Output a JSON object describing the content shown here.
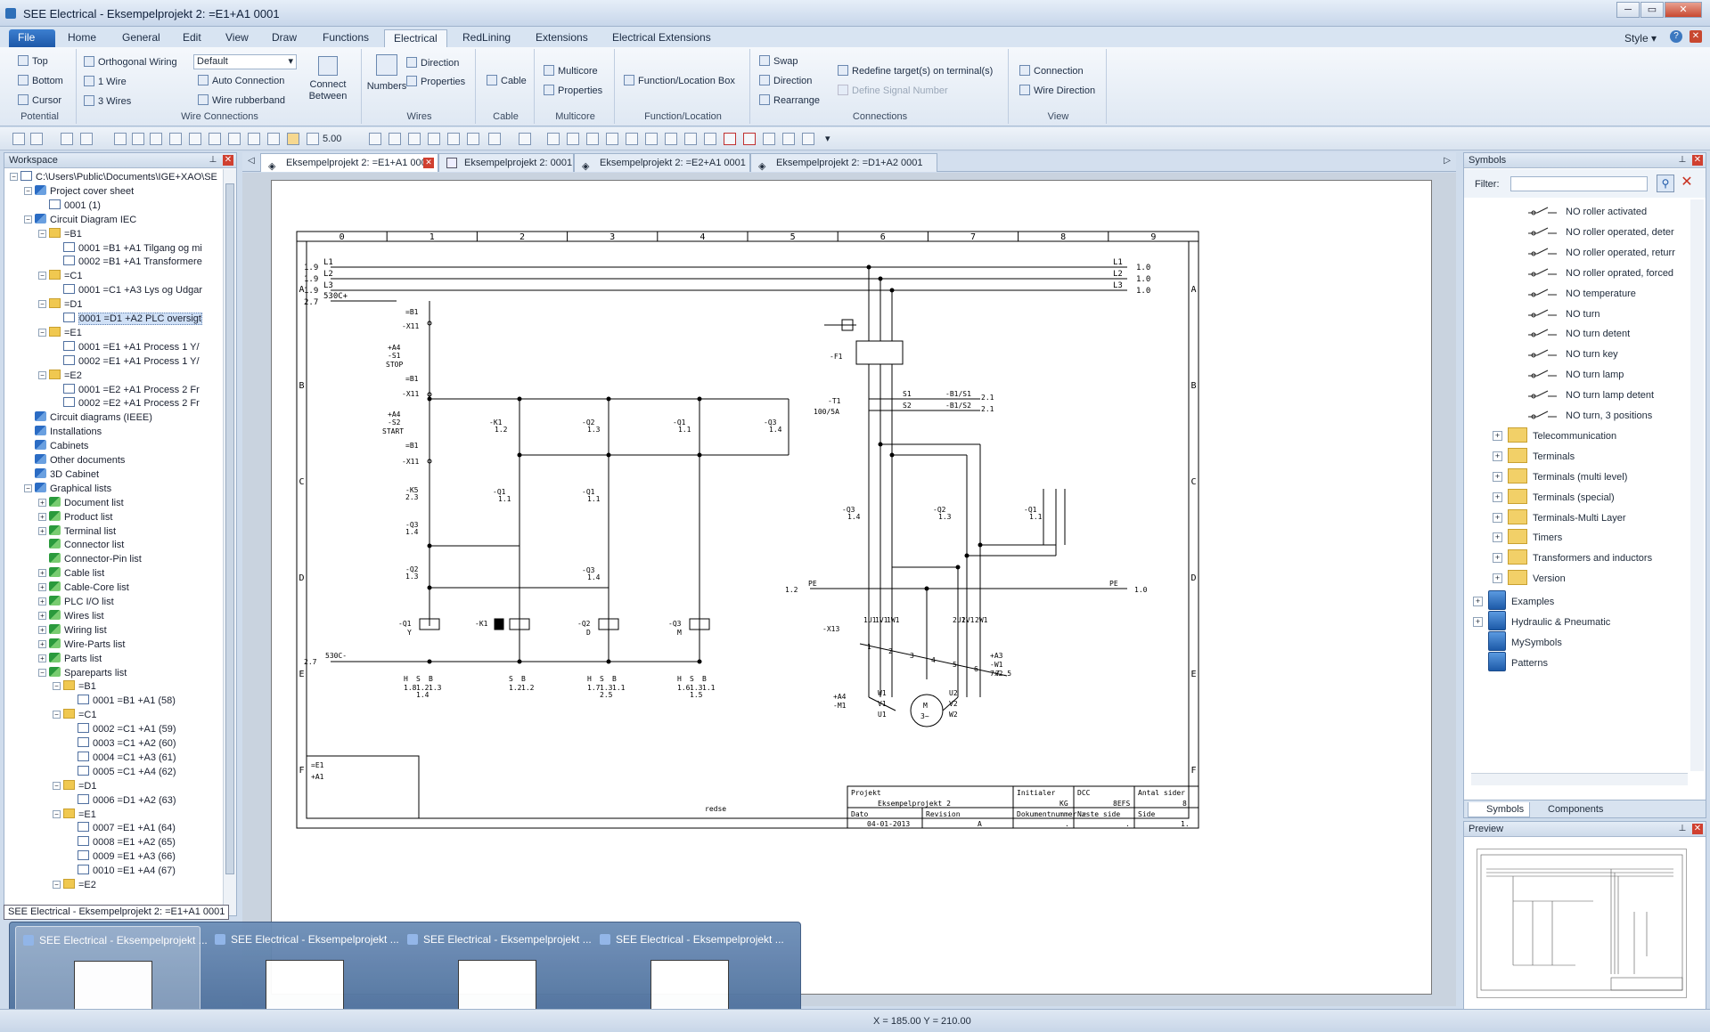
{
  "window": {
    "title": "SEE Electrical - Eksempelprojekt 2: =E1+A1 0001"
  },
  "ribbon_tabs": [
    "File",
    "Home",
    "General",
    "Edit",
    "View",
    "Draw",
    "Functions",
    "Electrical",
    "RedLining",
    "Extensions",
    "Electrical Extensions"
  ],
  "style_menu": "Style",
  "ribbon": {
    "potential": {
      "label": "Potential",
      "top": "Top",
      "bottom": "Bottom",
      "cursor": "Cursor"
    },
    "wire_connections": {
      "label": "Wire Connections",
      "orthogonal": "Orthogonal Wiring",
      "mode_value": "Default",
      "one_wire": "1 Wire",
      "three_wires": "3 Wires",
      "auto_connection": "Auto Connection",
      "wire_rubberband": "Wire rubberband",
      "connect_between": "Connect Between"
    },
    "wires": {
      "label": "Wires",
      "numbers": "Numbers",
      "direction": "Direction",
      "properties": "Properties"
    },
    "cable": {
      "label": "Cable",
      "cable": "Cable"
    },
    "multicore": {
      "label": "Multicore",
      "multicore": "Multicore",
      "properties": "Properties"
    },
    "function_location": {
      "label": "Function/Location",
      "box": "Function/Location Box"
    },
    "connections": {
      "label": "Connections",
      "swap": "Swap",
      "direction": "Direction",
      "rearrange": "Rearrange",
      "redefine": "Redefine target(s) on terminal(s)",
      "define_signal": "Define Signal Number"
    },
    "view": {
      "label": "View",
      "connection": "Connection",
      "wire_direction": "Wire Direction"
    }
  },
  "toolbar": {
    "zoom": "5.00"
  },
  "workspace": {
    "title": "Workspace",
    "tree": [
      {
        "label": "C:\\Users\\Public\\Documents\\IGE+XAO\\SE",
        "level": 0,
        "icon": "drive",
        "exp": "-"
      },
      {
        "label": "Project cover sheet",
        "level": 1,
        "icon": "diamond",
        "exp": "-"
      },
      {
        "label": "0001  (1)",
        "level": 2,
        "icon": "page",
        "exp": ""
      },
      {
        "label": "Circuit Diagram IEC",
        "level": 1,
        "icon": "diamond",
        "exp": "-"
      },
      {
        "label": "=B1",
        "level": 2,
        "icon": "folder",
        "exp": "-"
      },
      {
        "label": "0001 =B1 +A1 Tilgang og mi",
        "level": 3,
        "icon": "page",
        "exp": ""
      },
      {
        "label": "0002 =B1 +A1 Transformere",
        "level": 3,
        "icon": "page",
        "exp": ""
      },
      {
        "label": "=C1",
        "level": 2,
        "icon": "folder",
        "exp": "-"
      },
      {
        "label": "0001 =C1 +A3 Lys og Udgar",
        "level": 3,
        "icon": "page",
        "exp": ""
      },
      {
        "label": "=D1",
        "level": 2,
        "icon": "folder",
        "exp": "-"
      },
      {
        "label": "0001 =D1 +A2 PLC oversigt",
        "level": 3,
        "icon": "page",
        "exp": "",
        "selected": true
      },
      {
        "label": "=E1",
        "level": 2,
        "icon": "folder",
        "exp": "-"
      },
      {
        "label": "0001 =E1 +A1 Process 1 Y/",
        "level": 3,
        "icon": "page",
        "exp": ""
      },
      {
        "label": "0002 =E1 +A1 Process 1 Y/",
        "level": 3,
        "icon": "page",
        "exp": ""
      },
      {
        "label": "=E2",
        "level": 2,
        "icon": "folder",
        "exp": "-"
      },
      {
        "label": "0001 =E2 +A1 Process 2 Fr",
        "level": 3,
        "icon": "page",
        "exp": ""
      },
      {
        "label": "0002 =E2 +A1 Process 2 Fr",
        "level": 3,
        "icon": "page",
        "exp": ""
      },
      {
        "label": "Circuit diagrams (IEEE)",
        "level": 1,
        "icon": "diamond",
        "exp": ""
      },
      {
        "label": "Installations",
        "level": 1,
        "icon": "diamond",
        "exp": ""
      },
      {
        "label": "Cabinets",
        "level": 1,
        "icon": "diamond",
        "exp": ""
      },
      {
        "label": "Other documents",
        "level": 1,
        "icon": "diamond",
        "exp": ""
      },
      {
        "label": "3D Cabinet",
        "level": 1,
        "icon": "diamond",
        "exp": ""
      },
      {
        "label": "Graphical lists",
        "level": 1,
        "icon": "diamond",
        "exp": "-"
      },
      {
        "label": "Document list",
        "level": 2,
        "icon": "green",
        "exp": "+"
      },
      {
        "label": "Product list",
        "level": 2,
        "icon": "green",
        "exp": "+"
      },
      {
        "label": "Terminal list",
        "level": 2,
        "icon": "green",
        "exp": "+"
      },
      {
        "label": "Connector list",
        "level": 2,
        "icon": "green",
        "exp": ""
      },
      {
        "label": "Connector-Pin list",
        "level": 2,
        "icon": "green",
        "exp": ""
      },
      {
        "label": "Cable list",
        "level": 2,
        "icon": "green",
        "exp": "+"
      },
      {
        "label": "Cable-Core list",
        "level": 2,
        "icon": "green",
        "exp": "+"
      },
      {
        "label": "PLC I/O list",
        "level": 2,
        "icon": "green",
        "exp": "+"
      },
      {
        "label": "Wires list",
        "level": 2,
        "icon": "green",
        "exp": "+"
      },
      {
        "label": "Wiring list",
        "level": 2,
        "icon": "green",
        "exp": "+"
      },
      {
        "label": "Wire-Parts list",
        "level": 2,
        "icon": "green",
        "exp": "+"
      },
      {
        "label": "Parts list",
        "level": 2,
        "icon": "green",
        "exp": "+"
      },
      {
        "label": "Spareparts list",
        "level": 2,
        "icon": "green",
        "exp": "-"
      },
      {
        "label": "=B1",
        "level": 3,
        "icon": "folder",
        "exp": "-"
      },
      {
        "label": "0001 =B1 +A1 (58)",
        "level": 4,
        "icon": "page",
        "exp": ""
      },
      {
        "label": "=C1",
        "level": 3,
        "icon": "folder",
        "exp": "-"
      },
      {
        "label": "0002 =C1 +A1 (59)",
        "level": 4,
        "icon": "page",
        "exp": ""
      },
      {
        "label": "0003 =C1 +A2 (60)",
        "level": 4,
        "icon": "page",
        "exp": ""
      },
      {
        "label": "0004 =C1 +A3 (61)",
        "level": 4,
        "icon": "page",
        "exp": ""
      },
      {
        "label": "0005 =C1 +A4 (62)",
        "level": 4,
        "icon": "page",
        "exp": ""
      },
      {
        "label": "=D1",
        "level": 3,
        "icon": "folder",
        "exp": "-"
      },
      {
        "label": "0006 =D1 +A2 (63)",
        "level": 4,
        "icon": "page",
        "exp": ""
      },
      {
        "label": "=E1",
        "level": 3,
        "icon": "folder",
        "exp": "-"
      },
      {
        "label": "0007 =E1 +A1 (64)",
        "level": 4,
        "icon": "page",
        "exp": ""
      },
      {
        "label": "0008 =E1 +A2 (65)",
        "level": 4,
        "icon": "page",
        "exp": ""
      },
      {
        "label": "0009 =E1 +A3 (66)",
        "level": 4,
        "icon": "page",
        "exp": ""
      },
      {
        "label": "0010 =E1 +A4 (67)",
        "level": 4,
        "icon": "page",
        "exp": ""
      },
      {
        "label": "=E2",
        "level": 3,
        "icon": "folder",
        "exp": "-"
      }
    ]
  },
  "doc_tabs": [
    {
      "label": "Eksempelprojekt 2: =E1+A1 0001",
      "active": true
    },
    {
      "label": "Eksempelprojekt 2: 0001",
      "active": false
    },
    {
      "label": "Eksempelprojekt 2: =E2+A1 0001",
      "active": false
    },
    {
      "label": "Eksempelprojekt 2: =D1+A2 0001",
      "active": false
    }
  ],
  "drawing": {
    "columns": [
      "0",
      "1",
      "2",
      "3",
      "4",
      "5",
      "6",
      "7",
      "8",
      "9"
    ],
    "rows": [
      "A",
      "B",
      "C",
      "D",
      "E",
      "F"
    ],
    "left_refs": [
      "1.9",
      "1.9",
      "1.9",
      "2.7"
    ],
    "left_nets": [
      "L1",
      "L2",
      "L3",
      "530C+"
    ],
    "right_nets": [
      "L1",
      "L2",
      "L3"
    ],
    "right_refs": [
      "1.0",
      "1.0",
      "1.0"
    ],
    "control": {
      "b1_a": "=B1",
      "x11_a": "-X11",
      "s1_a4": "+A4",
      "s1": "-S1",
      "stop": "STOP",
      "b1_b": "=B1",
      "x11_b": "-X11",
      "s2_a4": "+A4",
      "s2": "-S2",
      "start": "START",
      "b1_c": "=B1",
      "x11_c": "-X11",
      "k5": "-K5",
      "k5_ref": "2.3",
      "q3": "-Q3",
      "q3_ref": "1.4",
      "q2": "-Q2",
      "q2_ref": "1.3",
      "k1": "-K1",
      "k1_ref": "1.2",
      "q2b": "-Q2",
      "q2b_ref": "1.3",
      "q1b": "-Q1",
      "q1b_ref": "1.1",
      "q3b": "-Q3",
      "q3b_ref": "1.4",
      "q1c": "-Q1",
      "q1c_ref": "1.1",
      "q1d": "-Q1",
      "q1d_ref": "1.1",
      "q3c": "-Q3",
      "q3c_ref": "1.4",
      "coil_q1": "-Q1",
      "coil_q1_sub": "Y",
      "coil_k1": "-K1",
      "coil_q2": "-Q2",
      "coil_q2_sub": "D",
      "coil_q3": "-Q3",
      "coil_q3_sub": "M",
      "bottom_ref": "2.7",
      "bottom_net": "530C-"
    },
    "crossrefs": [
      {
        "h": "H",
        "s": "S",
        "b": "B",
        "v1": "1.8",
        "v2": "1.2",
        "v3": "1.3",
        "v4": "1.4"
      },
      {
        "h": "",
        "s": "S",
        "b": "B",
        "v1": "",
        "v2": "1.2",
        "v3": "1.2",
        "v4": ""
      },
      {
        "h": "H",
        "s": "S",
        "b": "B",
        "v1": "1.7",
        "v2": "1.3",
        "v3": "1.1",
        "v4": "2.5"
      },
      {
        "h": "H",
        "s": "S",
        "b": "B",
        "v1": "1.6",
        "v2": "1.3",
        "v3": "1.1",
        "v4": "1.5"
      }
    ],
    "power": {
      "f1": "-F1",
      "b1": "=B1",
      "b1_t": "-T1",
      "b1_rating": "100/5A",
      "s1": "S1",
      "s2": "S2",
      "s1_tgt": "-B1/S1",
      "s2_tgt": "-B1/S2",
      "s1_ref": "2.1",
      "s2_ref": "2.1",
      "q3": "-Q3",
      "q3_ref": "1.4",
      "q2": "-Q2",
      "q2_ref": "1.3",
      "q1": "-Q1",
      "q1_ref": "1.1",
      "pe_left_ref": "1.2",
      "pe_left": "PE",
      "pe_right": "PE",
      "pe_right_ref": "1.0",
      "x13": "-X13",
      "terminals": [
        "1U1",
        "1V1",
        "1W1",
        "2U1",
        "2V1",
        "2W1"
      ],
      "term_nums": [
        "1",
        "2",
        "3",
        "4",
        "5",
        "6",
        "7"
      ],
      "cable_a3": "+A3",
      "cable_w1": "-W1",
      "cable_spec": "7x2.5",
      "motor_a4": "+A4",
      "motor": "-M1",
      "motor_m": "M",
      "motor_phase": "3~",
      "motor_terms": [
        "W1",
        "V1",
        "U1",
        "U2",
        "V2",
        "W2"
      ]
    },
    "title_block": {
      "location_e1": "=E1",
      "location_a1": "+A1",
      "projekt_label": "Projekt",
      "projekt_value": "Eksempelprojekt 2",
      "initialer_label": "Initialer",
      "initialer_value": "KG",
      "dcc_label": "DCC",
      "dcc_value": "8EFS",
      "antal_label": "Antal sider",
      "antal_value": "8",
      "dato_label": "Dato",
      "dato_value": "04-01-2013",
      "revision_label": "Revision",
      "revision_value": "A",
      "dok_label": "Dokumentnummer",
      "dok_value": ".",
      "naeste_label": "Næste side",
      "naeste_value": ".",
      "side_label": "Side",
      "side_value": "1.",
      "partial_text": "redse"
    }
  },
  "symbols": {
    "title": "Symbols",
    "filter_label": "Filter:",
    "items": [
      {
        "label": "NO roller activated",
        "type": "sym"
      },
      {
        "label": "NO roller operated, deter",
        "type": "sym"
      },
      {
        "label": "NO roller operated, returr",
        "type": "sym"
      },
      {
        "label": "NO roller oprated, forced",
        "type": "sym"
      },
      {
        "label": "NO temperature",
        "type": "sym"
      },
      {
        "label": "NO turn",
        "type": "sym"
      },
      {
        "label": "NO turn detent",
        "type": "sym"
      },
      {
        "label": "NO turn key",
        "type": "sym"
      },
      {
        "label": "NO turn lamp",
        "type": "sym"
      },
      {
        "label": "NO turn lamp detent",
        "type": "sym"
      },
      {
        "label": "NO turn, 3 positions",
        "type": "sym"
      },
      {
        "label": "Telecommunication",
        "type": "folder"
      },
      {
        "label": "Terminals",
        "type": "folder"
      },
      {
        "label": "Terminals (multi level)",
        "type": "folder"
      },
      {
        "label": "Terminals (special)",
        "type": "folder"
      },
      {
        "label": "Terminals-Multi Layer",
        "type": "folder"
      },
      {
        "label": "Timers",
        "type": "folder"
      },
      {
        "label": "Transformers and inductors",
        "type": "folder"
      },
      {
        "label": "Version",
        "type": "folder"
      },
      {
        "label": "Examples",
        "type": "book"
      },
      {
        "label": "Hydraulic & Pneumatic",
        "type": "book"
      },
      {
        "label": "MySymbols",
        "type": "book"
      },
      {
        "label": "Patterns",
        "type": "book"
      }
    ],
    "tabs": [
      "Symbols",
      "Components"
    ]
  },
  "preview": {
    "title": "Preview"
  },
  "tooltip": "SEE Electrical - Eksempelprojekt 2: =E1+A1 0001",
  "taskbar": [
    "SEE Electrical - Eksempelprojekt ...",
    "SEE Electrical - Eksempelprojekt ...",
    "SEE Electrical - Eksempelprojekt ...",
    "SEE Electrical - Eksempelprojekt ..."
  ],
  "status": {
    "coords": "X = 185.00  Y = 210.00"
  },
  "colors": {
    "accent": "#1d58a8",
    "ribbon": "#dfe8f3",
    "close": "#c84830"
  }
}
